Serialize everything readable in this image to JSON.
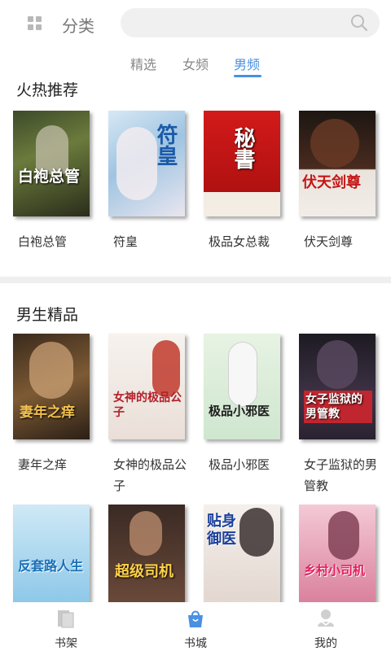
{
  "header": {
    "category_label": "分类",
    "search_placeholder": ""
  },
  "tabs": [
    {
      "label": "精选",
      "active": false
    },
    {
      "label": "女频",
      "active": false
    },
    {
      "label": "男频",
      "active": true
    }
  ],
  "sections": [
    {
      "title": "火热推荐",
      "books": [
        {
          "name": "白袍总管",
          "cover_text": "白袍总管"
        },
        {
          "name": "符皇",
          "cover_text": "符皇"
        },
        {
          "name": "极品女总裁",
          "cover_text": "秘書"
        },
        {
          "name": "伏天剑尊",
          "cover_text": "伏天剑尊"
        }
      ]
    },
    {
      "title": "男生精品",
      "books": [
        {
          "name": "妻年之痒",
          "cover_text": "妻年之痒"
        },
        {
          "name": "女神的极品公子",
          "cover_text": "女神的极品公子"
        },
        {
          "name": "极品小邪医",
          "cover_text": "极品小邪医"
        },
        {
          "name": "女子监狱的男管教",
          "cover_text": "女子监狱的男管教"
        }
      ]
    },
    {
      "title": "",
      "books": [
        {
          "name": "",
          "cover_text": "反套路人生"
        },
        {
          "name": "",
          "cover_text": "超级司机"
        },
        {
          "name": "",
          "cover_text": "贴身御医"
        },
        {
          "name": "",
          "cover_text": "乡村小司机"
        }
      ]
    }
  ],
  "bottom_nav": [
    {
      "label": "书架",
      "icon": "bookshelf-icon"
    },
    {
      "label": "书城",
      "icon": "bookstore-icon",
      "active": true
    },
    {
      "label": "我的",
      "icon": "profile-icon"
    }
  ],
  "colors": {
    "accent": "#4a90e2"
  }
}
